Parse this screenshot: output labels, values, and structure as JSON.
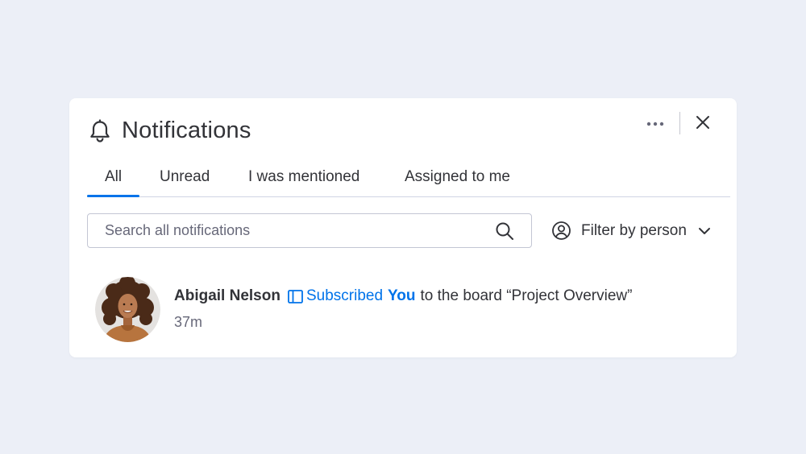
{
  "panel": {
    "title": "Notifications",
    "header_icons": [
      "bell-icon",
      "more-icon",
      "close-icon"
    ]
  },
  "tabs": [
    {
      "label": "All",
      "active": true
    },
    {
      "label": "Unread",
      "active": false
    },
    {
      "label": "I was mentioned",
      "active": false
    },
    {
      "label": "Assigned to me",
      "active": false
    }
  ],
  "search": {
    "placeholder": "Search all notifications",
    "value": "",
    "icon": "search-icon"
  },
  "filter": {
    "label": "Filter by person",
    "icon": "person-icon"
  },
  "notifications": [
    {
      "author": "Abigail Nelson",
      "icon": "board-icon",
      "action": "Subscribed",
      "target": "You",
      "text": "to the board “Project Overview”",
      "time": "37m"
    }
  ],
  "colors": {
    "background": "#ECEFF7",
    "panel": "#FFFFFF",
    "accent": "#0073EA",
    "text": "#323338",
    "secondary_text": "#676879"
  }
}
